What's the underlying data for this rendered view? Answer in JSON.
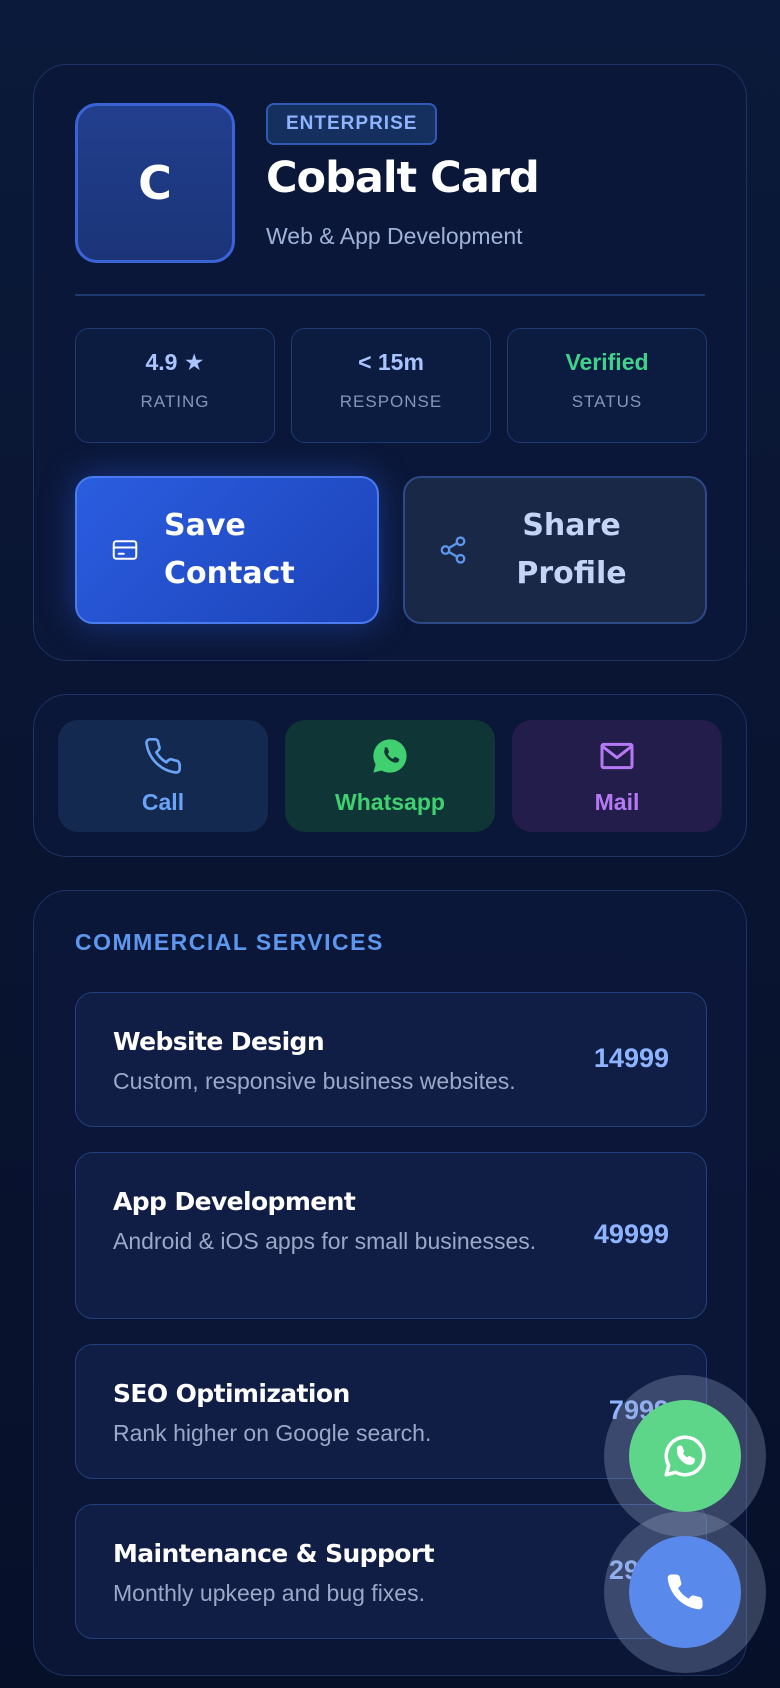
{
  "profile": {
    "logo_letter": "C",
    "badge": "ENTERPRISE",
    "name": "Cobalt Card",
    "subtitle": "Web & App Development",
    "stats": [
      {
        "value": "4.9 ★",
        "label": "RATING"
      },
      {
        "value": "< 15m",
        "label": "RESPONSE"
      },
      {
        "value": "Verified",
        "label": "STATUS"
      }
    ],
    "save_line1": "Save",
    "save_line2": "Contact",
    "share_line1": "Share",
    "share_line2": "Profile"
  },
  "contact": {
    "call": "Call",
    "whatsapp": "Whatsapp",
    "mail": "Mail"
  },
  "services": {
    "title": "COMMERCIAL SERVICES",
    "items": [
      {
        "name": "Website Design",
        "desc": "Custom, responsive business websites.",
        "price": "14999"
      },
      {
        "name": "App Development",
        "desc": "Android & iOS apps for small businesses.",
        "price": "49999"
      },
      {
        "name": "SEO Optimization",
        "desc": "Rank higher on Google search.",
        "price": "7999"
      },
      {
        "name": "Maintenance & Support",
        "desc": "Monthly upkeep and bug fixes.",
        "price": "2999"
      }
    ]
  },
  "colors": {
    "accent": "#2b5de0",
    "verified": "#3fd28a",
    "whatsapp": "#40d06f",
    "mail": "#b779f3",
    "call": "#6aa4f7"
  },
  "icons": [
    "card-icon",
    "share-icon",
    "phone-icon",
    "whatsapp-icon",
    "mail-icon"
  ]
}
